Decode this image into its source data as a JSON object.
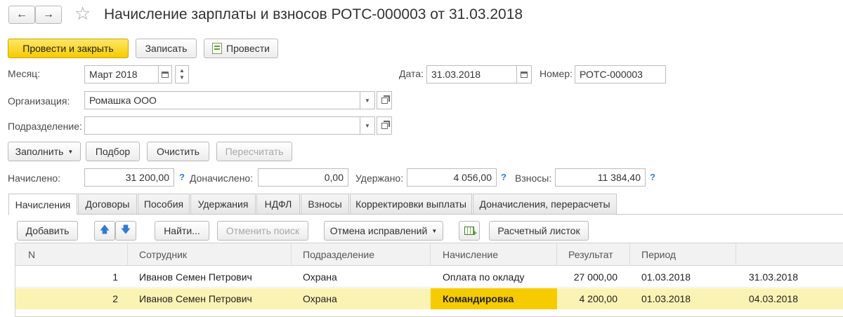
{
  "title": "Начисление зарплаты и взносов РОТС-000003 от 31.03.2018",
  "nav": {
    "back": "←",
    "forward": "→",
    "star": "☆"
  },
  "toolbar": {
    "post_close": "Провести и закрыть",
    "save": "Записать",
    "post": "Провести"
  },
  "form": {
    "month_label": "Месяц:",
    "month_value": "Март 2018",
    "date_label": "Дата:",
    "date_value": "31.03.2018",
    "number_label": "Номер:",
    "number_value": "РОТС-000003",
    "org_label": "Организация:",
    "org_value": "Ромашка ООО",
    "dept_label": "Подразделение:",
    "dept_value": ""
  },
  "actions": {
    "fill": "Заполнить",
    "select": "Подбор",
    "clear": "Очистить",
    "recalc": "Пересчитать"
  },
  "totals": {
    "accrued_label": "Начислено:",
    "accrued_value": "31 200,00",
    "extra_label": "Доначислено:",
    "extra_value": "0,00",
    "withheld_label": "Удержано:",
    "withheld_value": "4 056,00",
    "contrib_label": "Взносы:",
    "contrib_value": "11 384,40",
    "help": "?"
  },
  "tabs": [
    "Начисления",
    "Договоры",
    "Пособия",
    "Удержания",
    "НДФЛ",
    "Взносы",
    "Корректировки выплаты",
    "Доначисления, перерасчеты"
  ],
  "table_toolbar": {
    "add": "Добавить",
    "find": "Найти...",
    "cancel_search": "Отменить поиск",
    "cancel_fixes": "Отмена исправлений",
    "payslip": "Расчетный листок"
  },
  "table": {
    "columns": [
      "N",
      "Сотрудник",
      "Подразделение",
      "Начисление",
      "Результат",
      "Период",
      ""
    ],
    "rows": [
      {
        "n": "1",
        "employee": "Иванов Семен Петрович",
        "dept": "Охрана",
        "accrual": "Оплата по окладу",
        "result": "27 000,00",
        "period_from": "01.03.2018",
        "period_to": "31.03.2018"
      },
      {
        "n": "2",
        "employee": "Иванов Семен Петрович",
        "dept": "Охрана",
        "accrual": "Командировка",
        "result": "4 200,00",
        "period_from": "01.03.2018",
        "period_to": "04.03.2018"
      }
    ]
  },
  "colors": {
    "primary_button": "#f6cb00",
    "selected_row": "#fbf3b4",
    "selected_cell": "#f6cb00",
    "link_blue": "#2f7bd6"
  }
}
